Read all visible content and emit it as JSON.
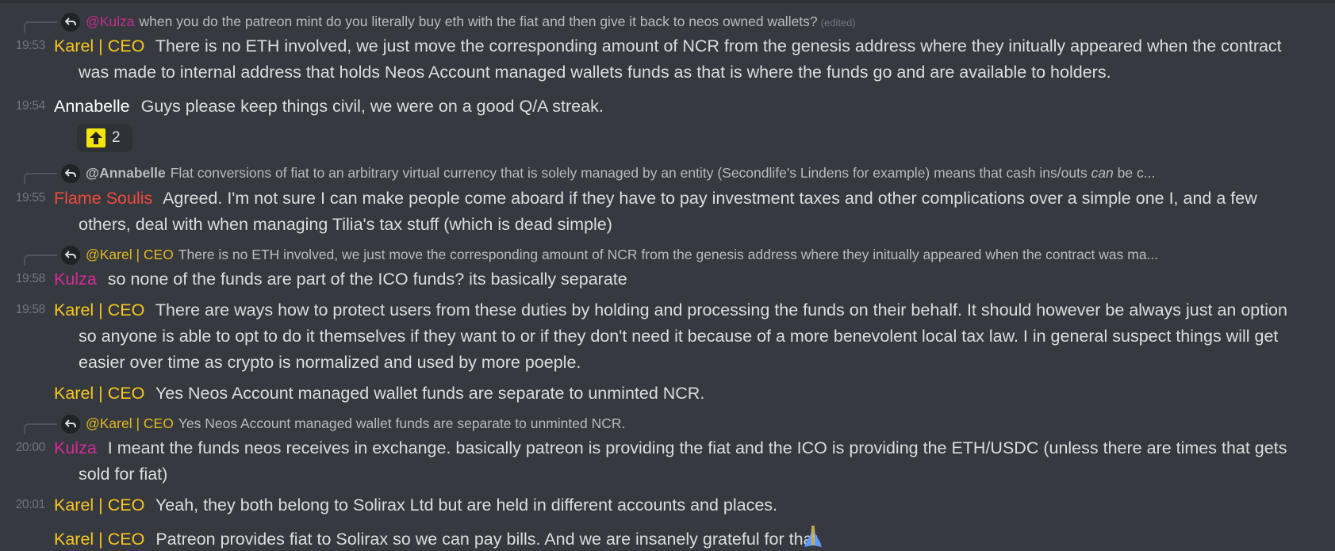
{
  "messages": {
    "r1": {
      "mention": "@Kulza",
      "text": "when you do the patreon mint do you literally buy eth with the fiat and then give it back to neos owned wallets?",
      "edited": "(edited)"
    },
    "m1": {
      "time": "19:53",
      "author": "Karel | CEO",
      "text": "There is no ETH involved, we just move the corresponding amount of NCR from the genesis address where they initually appeared when the contract was made to internal address that holds Neos Account managed wallets funds as that is where the funds go and are available to holders."
    },
    "m2": {
      "time": "19:54",
      "author": "Annabelle",
      "text": "Guys please keep things civil, we were on a good Q/A streak.",
      "reaction_count": "2",
      "reaction_icon": "arrow-up-emoji"
    },
    "r2": {
      "mention": "@Annabelle",
      "text_before": "Flat conversions of fiat to an arbitrary virtual currency that is solely managed by an entity (Secondlife's Lindens for example) means that cash ins/outs",
      "text_em": "can",
      "text_after": "be c..."
    },
    "m3": {
      "time": "19:55",
      "author": "Flame Soulis",
      "text": "Agreed.  I'm not sure I can make people come aboard if they have to pay investment taxes and other complications over a simple one I, and a few others, deal with when managing Tilia's tax stuff (which is dead simple)"
    },
    "r3": {
      "mention": "@Karel | CEO",
      "text": "There is no ETH involved, we just move the corresponding amount of NCR from the genesis address where they initually appeared when the contract was ma..."
    },
    "m4": {
      "time": "19:58",
      "author": "Kulza",
      "text": "so none of the  funds are part of the ICO funds? its basically separate"
    },
    "m5": {
      "time": "19:58",
      "author": "Karel | CEO",
      "text": "There are ways how to protect users from these duties by holding and processing the funds on their behalf. It should however be always just an option so anyone is able to opt to do it themselves if they want to or if they don't need it because of a more benevolent local tax law. I in general suspect things will get easier over time as crypto is normalized and used by more poeple."
    },
    "m6": {
      "author": "Karel | CEO",
      "text": "Yes Neos Account managed wallet funds are separate to unminted NCR."
    },
    "r4": {
      "mention": "@Karel | CEO",
      "text": "Yes Neos Account managed wallet funds are separate to unminted NCR."
    },
    "m7": {
      "time": "20:00",
      "author": "Kulza",
      "text": "I meant the funds neos receives in exchange. basically patreon is providing the fiat and the ICO is providing the ETH/USDC (unless there are times that gets sold for fiat)"
    },
    "m8": {
      "time": "20:01",
      "author": "Karel | CEO",
      "text": "Yeah, they both belong to Solirax Ltd but are held in different accounts and places."
    },
    "m9": {
      "author": "Karel | CEO",
      "text": "Patreon provides fiat to Solirax so we can pay bills. And we are insanely grateful for that.",
      "emoji": "folded-hands-emoji"
    }
  },
  "colors": {
    "background": "#36393f",
    "karel": "#f8c71e",
    "annabelle": "#ffffff",
    "flame": "#f04a3d",
    "kulza": "#d62a97",
    "text": "#dcddde",
    "muted": "#72767d"
  }
}
